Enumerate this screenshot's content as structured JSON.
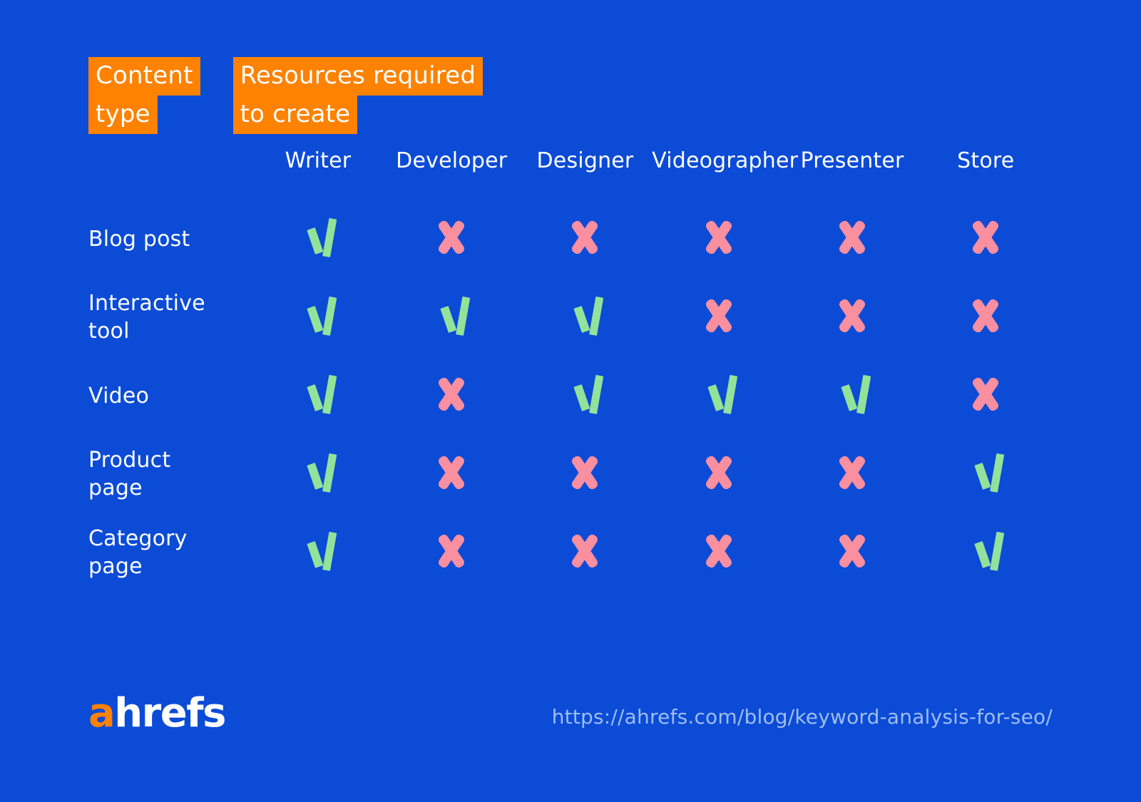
{
  "theme": {
    "background": "#0B4BD6",
    "highlight": "#FF8200",
    "text": "#FFFFFF",
    "yes_color": "#92E29A",
    "no_color": "#FA8FA0",
    "url_color": "#9FBDEE"
  },
  "headings": {
    "content_type": {
      "line1": "Content",
      "line2": "type"
    },
    "resources": {
      "line1": "Resources required",
      "line2": "to create"
    }
  },
  "table": {
    "label_column_header": "",
    "columns": [
      "Writer",
      "Developer",
      "Designer",
      "Videographer",
      "Presenter",
      "Store"
    ],
    "rows": [
      {
        "label": "Blog post",
        "marks": [
          "yes",
          "no",
          "no",
          "no",
          "no",
          "no"
        ]
      },
      {
        "label": "Interactive\ntool",
        "marks": [
          "yes",
          "yes",
          "yes",
          "no",
          "no",
          "no"
        ]
      },
      {
        "label": "Video",
        "marks": [
          "yes",
          "no",
          "yes",
          "yes",
          "yes",
          "no"
        ]
      },
      {
        "label": "Product\npage",
        "marks": [
          "yes",
          "no",
          "no",
          "no",
          "no",
          "yes"
        ]
      },
      {
        "label": "Category\npage",
        "marks": [
          "yes",
          "no",
          "no",
          "no",
          "no",
          "yes"
        ]
      }
    ]
  },
  "footer": {
    "logo": {
      "first_letter": "a",
      "remainder": "hrefs"
    },
    "source_url": "https://ahrefs.com/blog/keyword-analysis-for-seo/"
  },
  "chart_data": {
    "type": "table",
    "title": "Content type vs. Resources required to create",
    "categories": [
      "Writer",
      "Developer",
      "Designer",
      "Videographer",
      "Presenter",
      "Store"
    ],
    "series": [
      {
        "name": "Blog post",
        "values": [
          1,
          0,
          0,
          0,
          0,
          0
        ]
      },
      {
        "name": "Interactive tool",
        "values": [
          1,
          1,
          1,
          0,
          0,
          0
        ]
      },
      {
        "name": "Video",
        "values": [
          1,
          0,
          1,
          1,
          1,
          0
        ]
      },
      {
        "name": "Product page",
        "values": [
          1,
          0,
          0,
          0,
          0,
          1
        ]
      },
      {
        "name": "Category page",
        "values": [
          1,
          0,
          0,
          0,
          0,
          1
        ]
      }
    ],
    "value_legend": {
      "1": "required (check)",
      "0": "not required (cross)"
    },
    "xlabel": "Resources required to create",
    "ylabel": "Content type",
    "grid": false,
    "legend": "none"
  }
}
